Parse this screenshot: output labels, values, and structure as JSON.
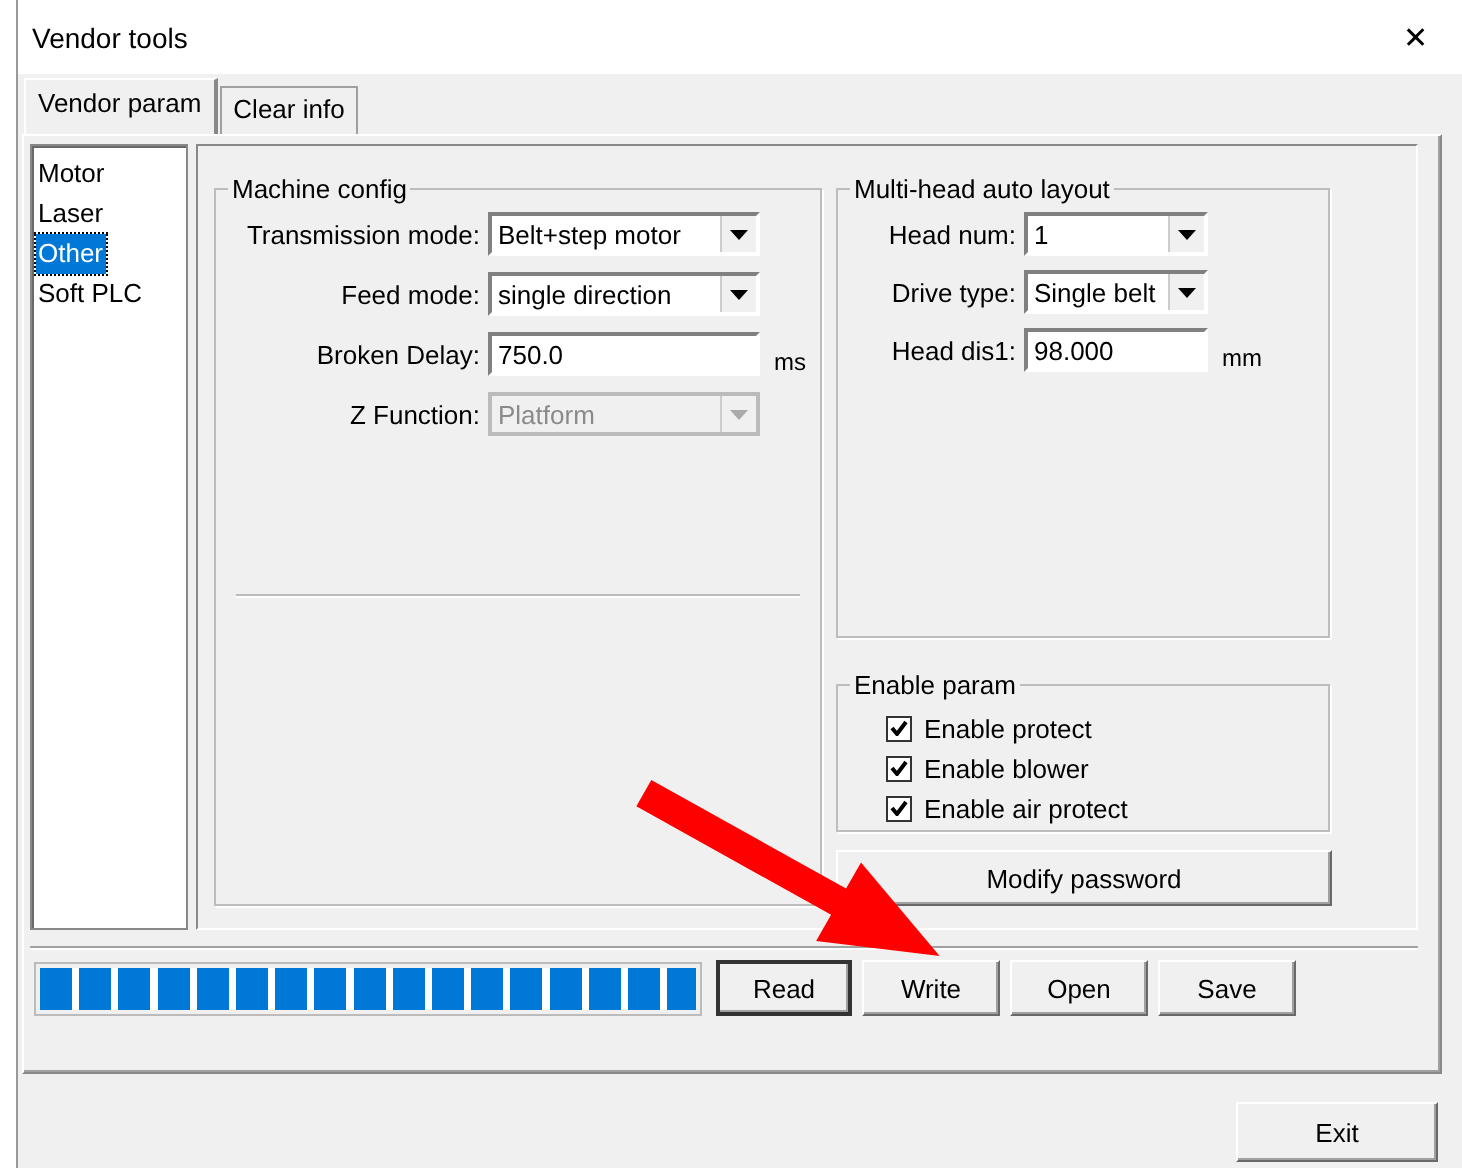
{
  "window": {
    "title": "Vendor tools",
    "close": "✕"
  },
  "tabs": [
    {
      "label": "Vendor param",
      "selected": true
    },
    {
      "label": "Clear info",
      "selected": false
    }
  ],
  "categories": [
    {
      "label": "Motor",
      "selected": false
    },
    {
      "label": "Laser",
      "selected": false
    },
    {
      "label": "Other",
      "selected": true
    },
    {
      "label": "Soft PLC",
      "selected": false
    }
  ],
  "machine_config": {
    "title": "Machine config",
    "fields": [
      {
        "label": "Transmission mode:",
        "kind": "select",
        "value": "Belt+step motor",
        "disabled": false
      },
      {
        "label": "Feed mode:",
        "kind": "select",
        "value": "single direction",
        "disabled": false
      },
      {
        "label": "Broken Delay:",
        "kind": "text",
        "value": "750.0",
        "unit": "ms",
        "disabled": false
      },
      {
        "label": "Z Function:",
        "kind": "select",
        "value": "Platform",
        "disabled": true
      }
    ]
  },
  "multi_head": {
    "title": "Multi-head auto layout",
    "fields": [
      {
        "label": "Head num:",
        "kind": "select",
        "value": "1",
        "disabled": false
      },
      {
        "label": "Drive type:",
        "kind": "select",
        "value": "Single belt",
        "disabled": false
      },
      {
        "label": "Head dis1:",
        "kind": "text",
        "value": "98.000",
        "unit": "mm",
        "disabled": false
      }
    ]
  },
  "enable_param": {
    "title": "Enable param",
    "options": [
      {
        "label": "Enable protect",
        "checked": true
      },
      {
        "label": "Enable blower",
        "checked": true
      },
      {
        "label": "Enable air protect",
        "checked": true
      }
    ]
  },
  "modify_password": "Modify password",
  "progress": {
    "level": 1
  },
  "actions": [
    {
      "label": "Read",
      "selected": true
    },
    {
      "label": "Write",
      "selected": false
    },
    {
      "label": "Open",
      "selected": false
    },
    {
      "label": "Save",
      "selected": false
    }
  ],
  "exit": "Exit"
}
